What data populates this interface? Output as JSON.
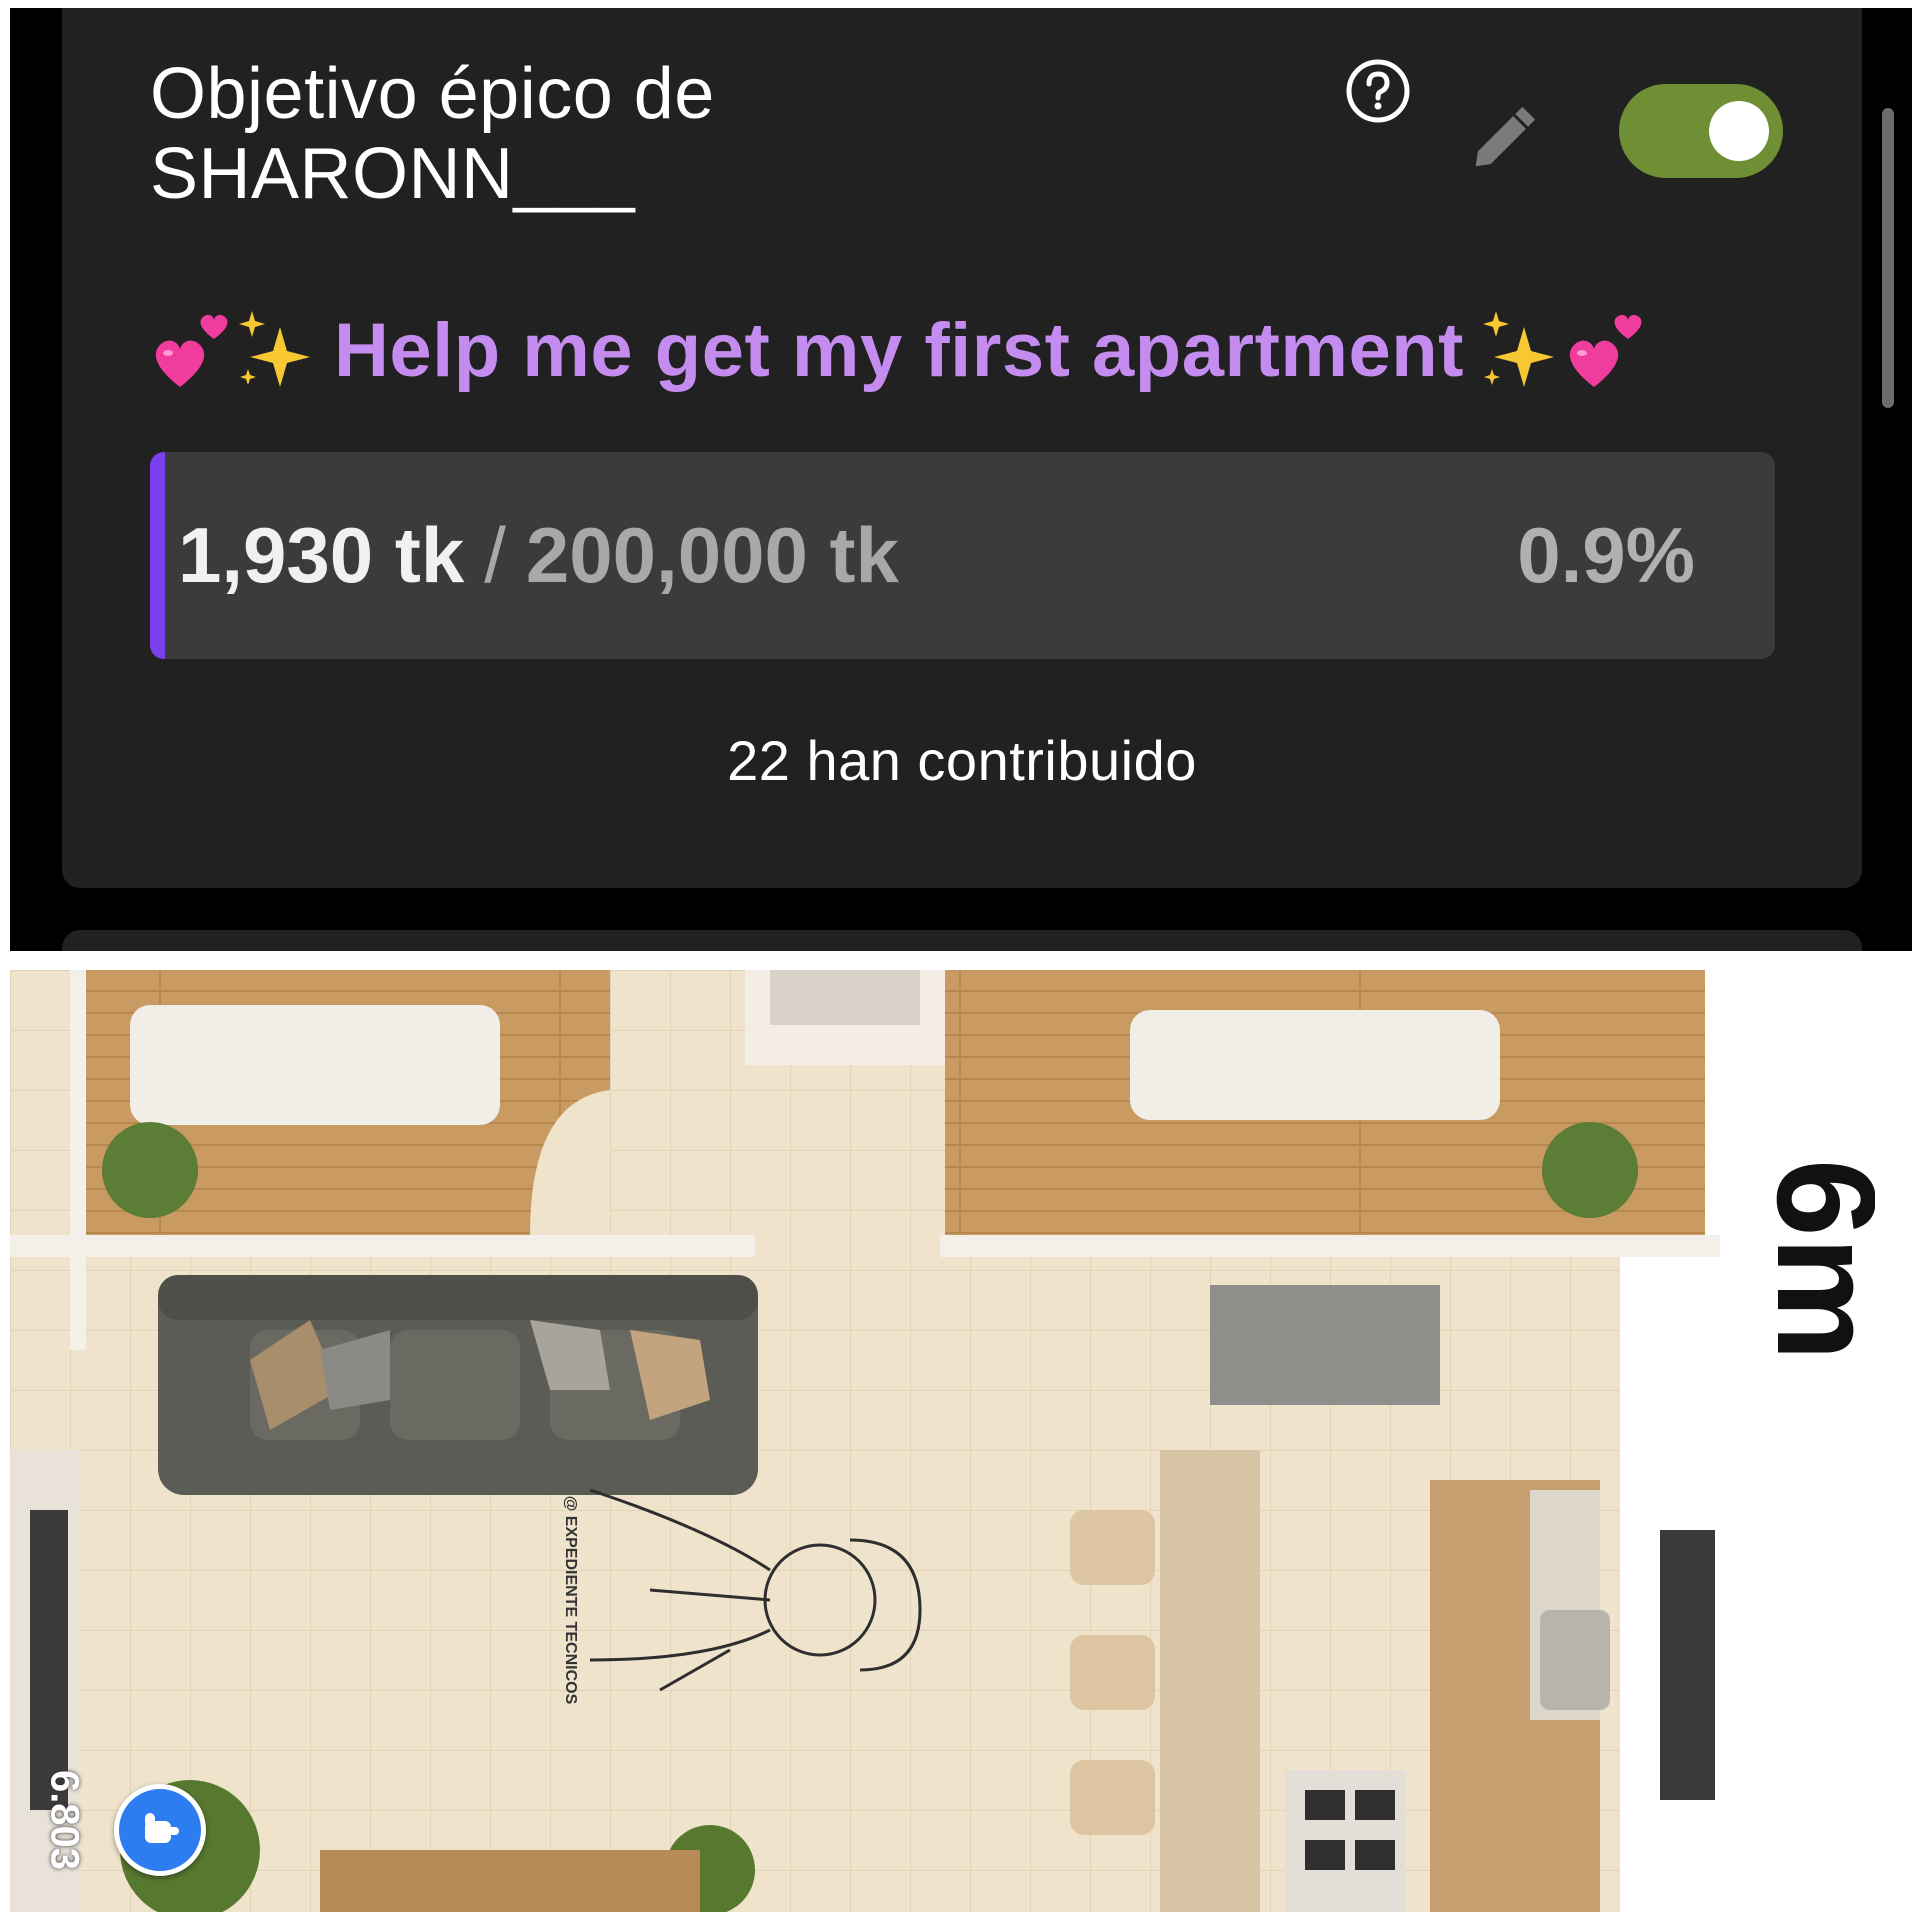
{
  "goal": {
    "title_line1": "Objetivo épico de",
    "title_line2": "SHARONN___",
    "description": "Help me get my first apartment",
    "description_decoration_icons": [
      "two-hearts-emoji",
      "sparkles-emoji"
    ],
    "current": "1,930 tk",
    "separator": "/",
    "target": "200,000 tk",
    "percent_label": "0.9%",
    "progress_fraction": 0.009,
    "contributors": "22 han contribuido",
    "toggle_on": true,
    "accent_color": "#7b3ff0",
    "description_color": "#c58cf0",
    "toggle_color": "#6f8f35"
  },
  "header_icons": [
    "help-icon",
    "pencil-edit-icon",
    "toggle-switch"
  ],
  "image": {
    "kind": "apartment floor plan render",
    "scale_label": "6m",
    "side_reading": "6.803",
    "watermark": "@ EXPEDIENTE TECNICOS",
    "float_button_icon": "hand-pointer-icon"
  }
}
